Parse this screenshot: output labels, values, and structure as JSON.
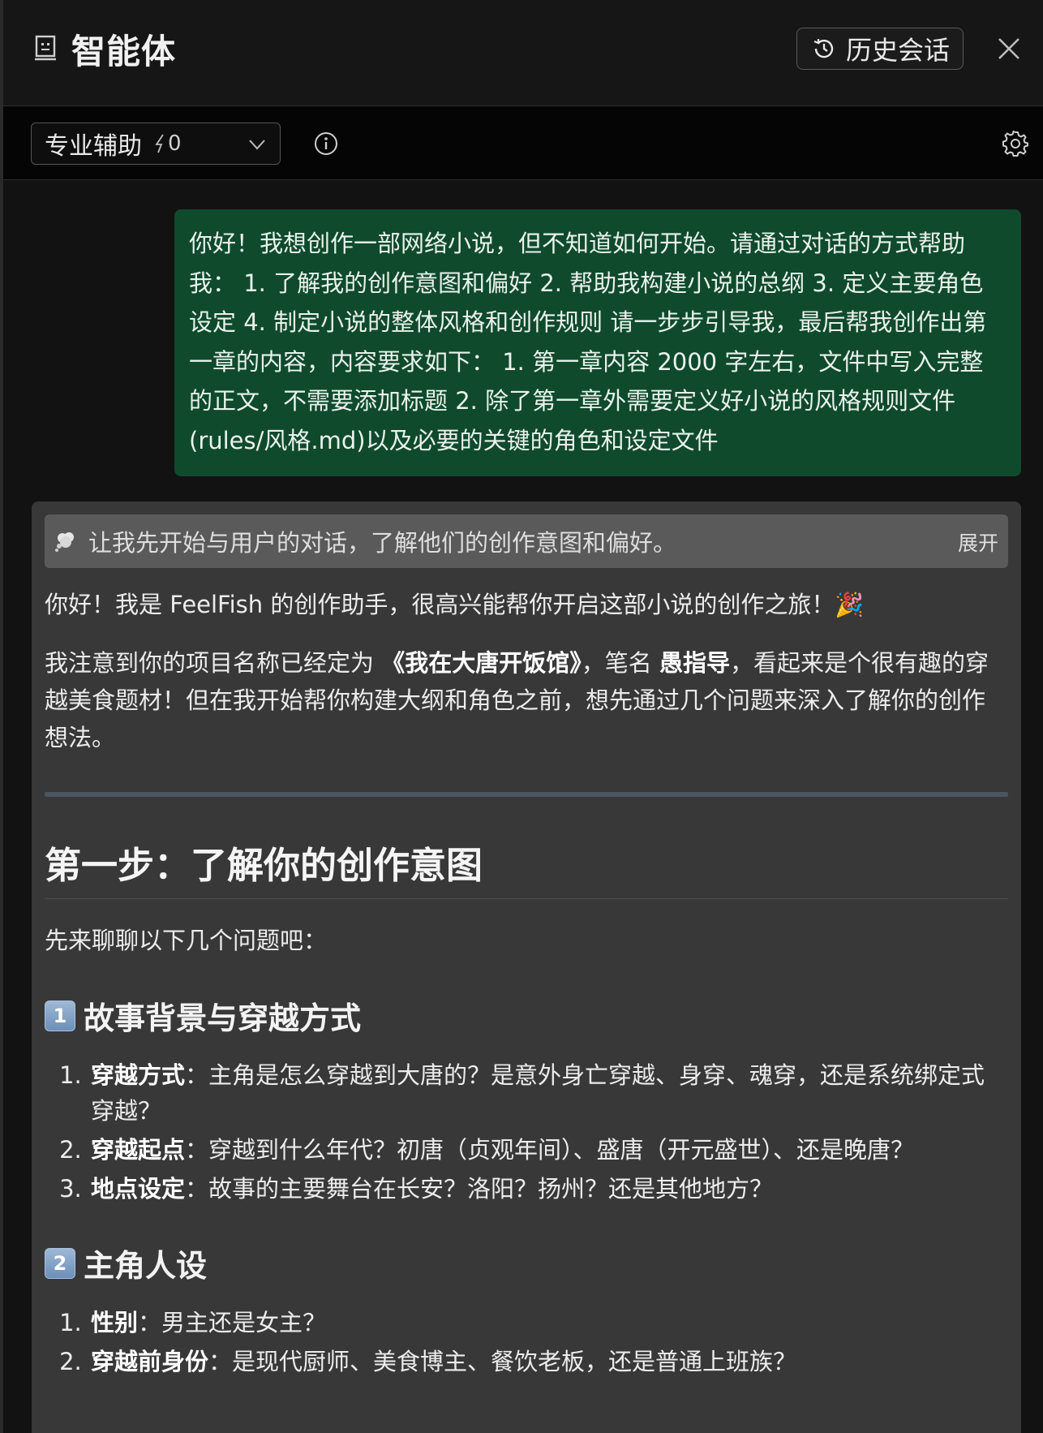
{
  "header": {
    "title": "智能体",
    "history_label": "历史会话",
    "agent_icon": "robot-face-icon",
    "history_icon": "history-clock-icon",
    "close_icon": "close-icon"
  },
  "toolbar": {
    "mode_label": "专业辅助",
    "credit_value": "0",
    "credit_icon": "lightning-icon",
    "chevron_icon": "chevron-down-icon",
    "info_icon": "info-icon",
    "settings_icon": "gear-icon"
  },
  "user_message": "你好！我想创作一部网络小说，但不知道如何开始。请通过对话的方式帮助我： 1. 了解我的创作意图和偏好 2. 帮助我构建小说的总纲 3. 定义主要角色设定 4. 制定小说的整体风格和创作规则 请一步步引导我，最后帮我创作出第一章的内容，内容要求如下： 1. 第一章内容 2000 字左右，文件中写入完整的正文，不需要添加标题 2. 除了第一章外需要定义好小说的风格规则文件(rules/风格.md)以及必要的关键的角色和设定文件",
  "assistant": {
    "thought": {
      "text": "让我先开始与用户的对话，了解他们的创作意图和偏好。",
      "expand_label": "展开",
      "icon": "thought-bubble-icon"
    },
    "greeting": "你好！我是 FeelFish 的创作助手，很高兴能帮你开启这部小说的创作之旅！🎉",
    "intro": {
      "part1": "我注意到你的项目名称已经定为 ",
      "project_name": "《我在大唐开饭馆》",
      "part2": "，笔名 ",
      "pen_name": "愚指导",
      "part3": "，看起来是个很有趣的穿越美食题材！但在我开始帮你构建大纲和角色之前，想先通过几个问题来深入了解你的创作想法。"
    },
    "step_title": "第一步：了解你的创作意图",
    "step_intro": "先来聊聊以下几个问题吧：",
    "sections": [
      {
        "number": "1",
        "title": "故事背景与穿越方式",
        "items": [
          {
            "label": "穿越方式",
            "text": "：主角是怎么穿越到大唐的？是意外身亡穿越、身穿、魂穿，还是系统绑定式穿越？"
          },
          {
            "label": "穿越起点",
            "text": "：穿越到什么年代？初唐（贞观年间）、盛唐（开元盛世）、还是晚唐？"
          },
          {
            "label": "地点设定",
            "text": "：故事的主要舞台在长安？洛阳？扬州？还是其他地方？"
          }
        ]
      },
      {
        "number": "2",
        "title": "主角人设",
        "items": [
          {
            "label": "性别",
            "text": "：男主还是女主？"
          },
          {
            "label": "穿越前身份",
            "text": "：是现代厨师、美食博主、餐饮老板，还是普通上班族？"
          }
        ]
      }
    ]
  }
}
